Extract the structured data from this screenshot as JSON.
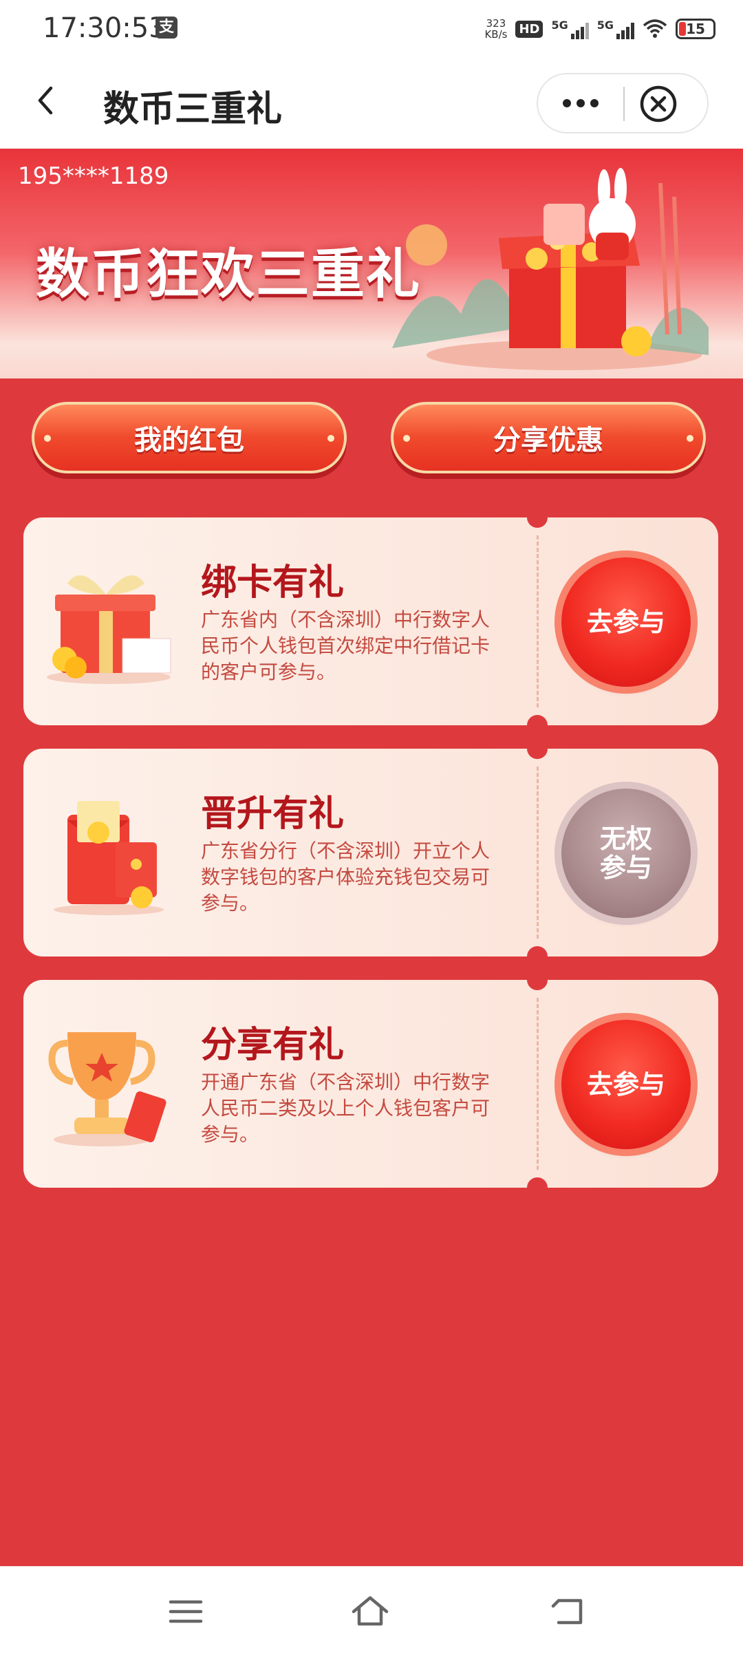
{
  "status_bar": {
    "time": "17:30:53",
    "app_icon": "支",
    "net_speed_value": "323",
    "net_speed_unit": "KB/s",
    "hd_label": "HD",
    "signal1_label": "5G",
    "signal2_label": "5G",
    "battery": "15",
    "icons": [
      "hd-icon",
      "signal-icon",
      "wifi-icon",
      "battery-icon"
    ]
  },
  "nav": {
    "title": "数币三重礼",
    "icons": [
      "back-arrow-icon",
      "more-dots-icon",
      "close-circle-icon"
    ]
  },
  "banner": {
    "phone": "195****1189",
    "title": "数币狂欢三重礼"
  },
  "actions": {
    "red_packet": "我的红包",
    "share_deal": "分享优惠"
  },
  "cards": [
    {
      "title": "绑卡有礼",
      "desc": "广东省内（不含深圳）中行数字人民币个人钱包首次绑定中行借记卡的客户可参与。",
      "button": "去参与",
      "state": "active",
      "icon": "gift-box-icon"
    },
    {
      "title": "晋升有礼",
      "desc": "广东省分行（不含深圳）开立个人数字钱包的客户体验充钱包交易可参与。",
      "button_line1": "无权",
      "button_line2": "参与",
      "state": "disabled",
      "icon": "red-envelope-icon"
    },
    {
      "title": "分享有礼",
      "desc": "开通广东省（不含深圳）中行数字人民币二类及以上个人钱包客户可参与。",
      "button": "去参与",
      "state": "active",
      "icon": "trophy-icon"
    }
  ],
  "colors": {
    "page_red": "#de3a3d",
    "card_bg": "#fdf1ea",
    "title_red": "#b3171c",
    "button_red": "#f12b22",
    "disabled_grey": "#a9898c"
  },
  "system_nav": {
    "icons": [
      "menu-icon",
      "home-icon",
      "back-icon"
    ]
  }
}
